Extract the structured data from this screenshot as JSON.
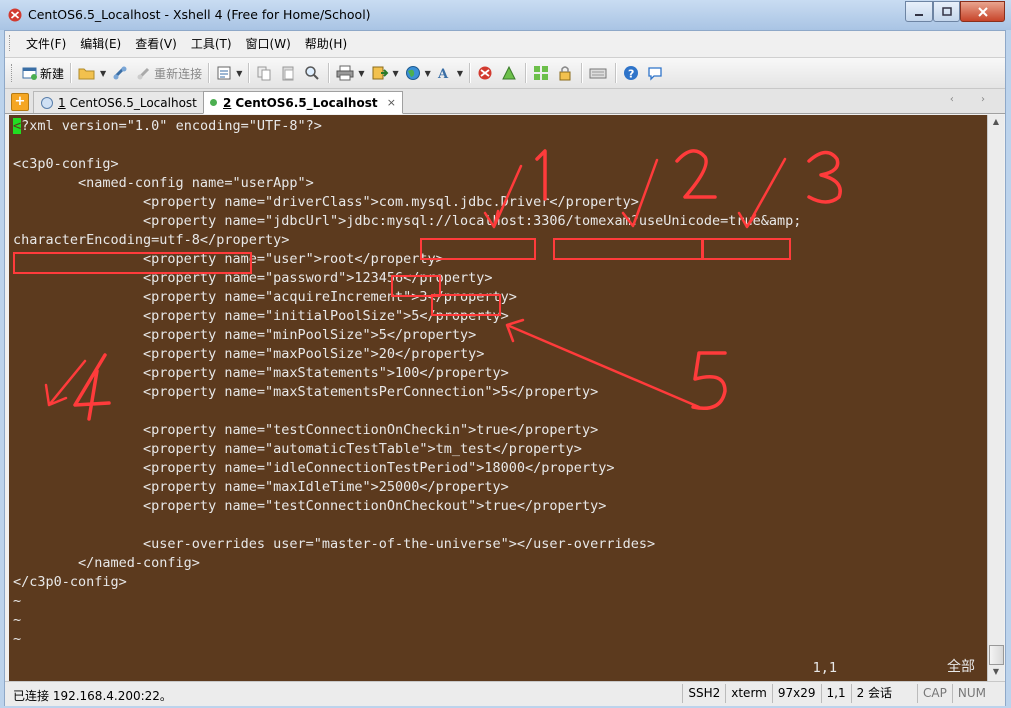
{
  "window": {
    "title": "CentOS6.5_Localhost - Xshell 4 (Free for Home/School)",
    "min": "0",
    "max": "1",
    "close": "r"
  },
  "menu": [
    "文件(F)",
    "编辑(E)",
    "查看(V)",
    "工具(T)",
    "窗口(W)",
    "帮助(H)"
  ],
  "toolbar": {
    "new_label": "新建",
    "reconnect_label": "重新连接"
  },
  "tabs": [
    {
      "num": "1",
      "label": "CentOS6.5_Localhost"
    },
    {
      "num": "2",
      "label": "CentOS6.5_Localhost"
    }
  ],
  "tab_close": "×",
  "tab_nav": "‹ ›",
  "terminal": {
    "lines": [
      "?xml version=\"1.0\" encoding=\"UTF-8\"?>",
      "",
      "<c3p0-config>",
      "        <named-config name=\"userApp\">",
      "                <property name=\"driverClass\">com.mysql.jdbc.Driver</property>",
      "                <property name=\"jdbcUrl\">jdbc:mysql://localhost:3306/tomexam?useUnicode=true&amp;",
      "characterEncoding=utf-8</property>",
      "                <property name=\"user\">root</property>",
      "                <property name=\"password\">123456</property>",
      "                <property name=\"acquireIncrement\">3</property>",
      "                <property name=\"initialPoolSize\">5</property>",
      "                <property name=\"minPoolSize\">5</property>",
      "                <property name=\"maxPoolSize\">20</property>",
      "                <property name=\"maxStatements\">100</property>",
      "                <property name=\"maxStatementsPerConnection\">5</property>",
      "",
      "                <property name=\"testConnectionOnCheckin\">true</property>",
      "                <property name=\"automaticTestTable\">tm_test</property>",
      "                <property name=\"idleConnectionTestPeriod\">18000</property>",
      "                <property name=\"maxIdleTime\">25000</property>",
      "                <property name=\"testConnectionOnCheckout\">true</property>",
      "",
      "                <user-overrides user=\"master-of-the-universe\"></user-overrides>",
      "        </named-config>",
      "</c3p0-config>",
      "~",
      "~",
      "~"
    ],
    "cursor_char": "<",
    "position": "1,1",
    "mode": "全部"
  },
  "annotations": [
    "1",
    "2",
    "3",
    "4",
    "5"
  ],
  "annotation_color": "#ff3b3b",
  "status": {
    "connection": "已连接 192.168.4.200:22。",
    "protocol": "SSH2",
    "terminal_type": "xterm",
    "size": "97x29",
    "cursor": "1,1",
    "sessions": "2 会话",
    "caps": "CAP",
    "num": "NUM"
  }
}
